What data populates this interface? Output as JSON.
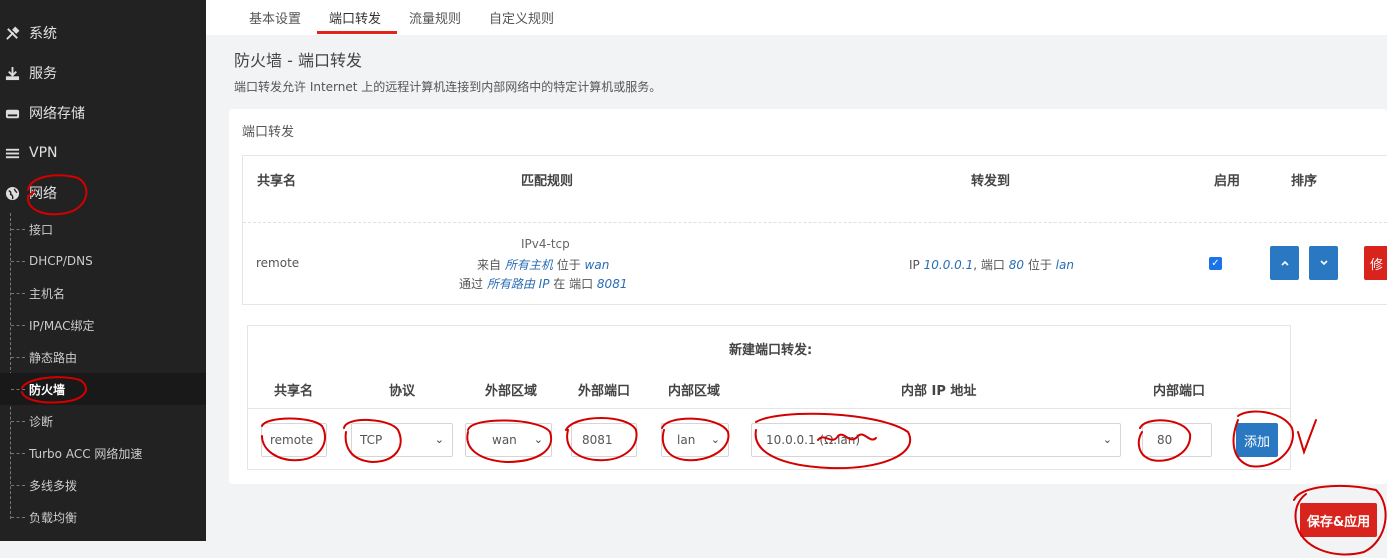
{
  "sidebar": {
    "menu": [
      {
        "label": "系统",
        "icon": "tools-icon"
      },
      {
        "label": "服务",
        "icon": "download-icon"
      },
      {
        "label": "网络存储",
        "icon": "storage-icon"
      },
      {
        "label": "VPN",
        "icon": "list-icon"
      },
      {
        "label": "网络",
        "icon": "globe-icon"
      }
    ],
    "sub_items": [
      "接口",
      "DHCP/DNS",
      "主机名",
      "IP/MAC绑定",
      "静态路由",
      "防火墙",
      "诊断",
      "Turbo ACC 网络加速",
      "多线多拨",
      "负载均衡"
    ],
    "active_sub": "防火墙"
  },
  "tabs": [
    "基本设置",
    "端口转发",
    "流量规则",
    "自定义规则"
  ],
  "active_tab": "端口转发",
  "page": {
    "heading": "防火墙 - 端口转发",
    "description": "端口转发允许 Internet 上的远程计算机连接到内部网络中的特定计算机或服务。",
    "section_title": "端口转发"
  },
  "rules_table": {
    "headers": {
      "name": "共享名",
      "match": "匹配规则",
      "forward": "转发到",
      "enable": "启用",
      "sort": "排序"
    },
    "rows": [
      {
        "name": "remote",
        "proto": "IPv4-tcp",
        "from_prefix": "来自",
        "from_host": "所有主机",
        "from_mid": "位于",
        "from_zone": "wan",
        "via_prefix": "通过",
        "via_target": "所有路由 IP",
        "via_mid": "在 端口",
        "via_port": "8081",
        "fwd_prefix": "IP",
        "fwd_ip": "10.0.0.1",
        "fwd_port_label": ", 端口",
        "fwd_port": "80",
        "fwd_zone_label": "位于",
        "fwd_zone": "lan",
        "enabled": true,
        "edit_label": "修"
      }
    ]
  },
  "new_forward": {
    "title": "新建端口转发:",
    "headers": {
      "name": "共享名",
      "proto": "协议",
      "ext_zone": "外部区域",
      "ext_port": "外部端口",
      "int_zone": "内部区域",
      "int_ip": "内部 IP 地址",
      "int_port": "内部端口"
    },
    "values": {
      "name": "remote",
      "proto": "TCP",
      "ext_zone": "wan",
      "ext_port": "8081",
      "int_zone": "lan",
      "int_ip": "10.0.0.1 (Ω.lan)",
      "int_port": "80"
    },
    "add_label": "添加"
  },
  "save_apply_label": "保存&应用",
  "colors": {
    "accent_red": "#d9231d",
    "primary_blue": "#2b78c2",
    "sidebar_bg": "#222222",
    "annotation": "#d40000"
  }
}
